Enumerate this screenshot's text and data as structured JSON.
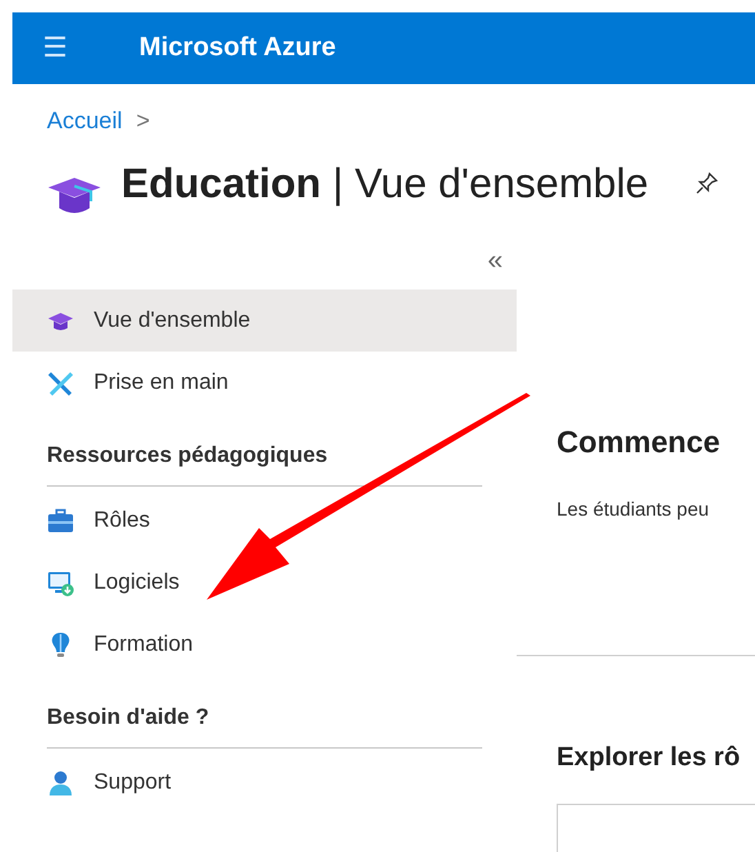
{
  "header": {
    "menu_glyph": "☰",
    "title": "Microsoft Azure"
  },
  "breadcrumb": {
    "link": "Accueil",
    "separator": ">"
  },
  "page_title": {
    "name": "Education",
    "separator": "|",
    "subtitle": "Vue d'ensemble"
  },
  "sidebar": {
    "collapse_glyph": "«",
    "sections": [
      {
        "items": [
          {
            "label": "Vue d'ensemble",
            "selected": true
          },
          {
            "label": "Prise en main",
            "selected": false
          }
        ]
      },
      {
        "title": "Ressources pédagogiques",
        "items": [
          {
            "label": "Rôles",
            "selected": false
          },
          {
            "label": "Logiciels",
            "selected": false
          },
          {
            "label": "Formation",
            "selected": false
          }
        ]
      },
      {
        "title": "Besoin d'aide ?",
        "items": [
          {
            "label": "Support",
            "selected": false
          }
        ]
      }
    ]
  },
  "content": {
    "heading": "Commence",
    "text": "Les étudiants peu",
    "section_heading": "Explorer les rô"
  }
}
